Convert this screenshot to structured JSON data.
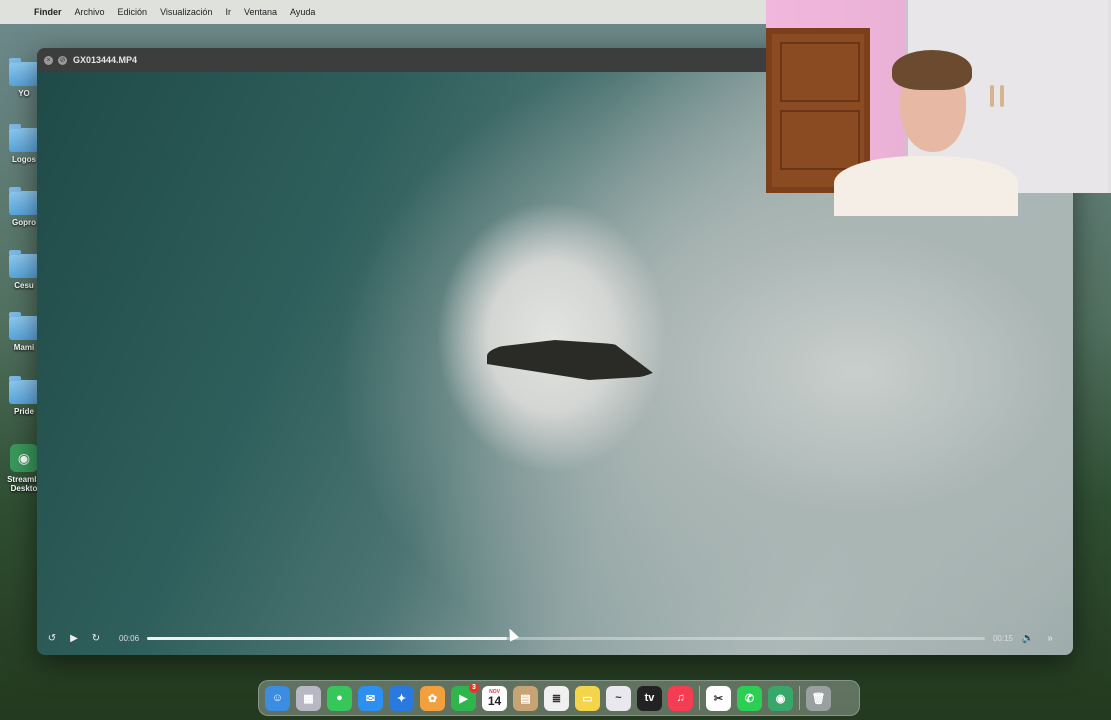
{
  "menubar": {
    "items": [
      "Finder",
      "Archivo",
      "Edición",
      "Visualización",
      "Ir",
      "Ventana",
      "Ayuda"
    ]
  },
  "desktop": {
    "icons": [
      {
        "label": "YO",
        "kind": "folder"
      },
      {
        "label": "Logos",
        "kind": "folder"
      },
      {
        "label": "Gopro",
        "kind": "folder"
      },
      {
        "label": "Cesu",
        "kind": "folder"
      },
      {
        "label": "Mami",
        "kind": "folder"
      },
      {
        "label": "Pride",
        "kind": "folder"
      },
      {
        "label": "Streamla Deskto",
        "kind": "app"
      }
    ]
  },
  "player": {
    "title": "GX013444.MP4",
    "time_current": "00:06",
    "time_total": "00:15",
    "progress": 0.43,
    "icons": [
      "back-10-icon",
      "play-icon",
      "forward-10-icon",
      "volume-icon",
      "fast-forward-icon"
    ]
  },
  "dock": {
    "apps": [
      {
        "name": "finder-app",
        "color": "#3a8de0",
        "glyph": "☺"
      },
      {
        "name": "launchpad-app",
        "color": "#b8b8c4",
        "glyph": "▦"
      },
      {
        "name": "messages-app",
        "color": "#35c759",
        "glyph": "●"
      },
      {
        "name": "mail-app",
        "color": "#2d8ff0",
        "glyph": "✉"
      },
      {
        "name": "safari-app",
        "color": "#2a79de",
        "glyph": "✦"
      },
      {
        "name": "photos-app",
        "color": "#f2a03d",
        "glyph": "✿"
      },
      {
        "name": "facetime-app",
        "color": "#2fb44e",
        "glyph": "▶",
        "badge": "3"
      },
      {
        "name": "calendar-app",
        "color": "#ffffff",
        "calendar_month": "NOV",
        "calendar_day": "14"
      },
      {
        "name": "notes-app",
        "color": "#c8a374",
        "glyph": "▤"
      },
      {
        "name": "reminders-app",
        "color": "#f0f0f0",
        "glyph": "≣"
      },
      {
        "name": "stickies-app",
        "color": "#f4d44a",
        "glyph": "▭"
      },
      {
        "name": "freeform-app",
        "color": "#e8e8ee",
        "glyph": "~"
      },
      {
        "name": "tv-app",
        "color": "#222222",
        "glyph": "tv"
      },
      {
        "name": "music-app",
        "color": "#f43c52",
        "glyph": "♫"
      },
      {
        "name": "capcut-app",
        "color": "#ffffff",
        "glyph": "✂"
      },
      {
        "name": "whatsapp-app",
        "color": "#2ccf54",
        "glyph": "✆"
      },
      {
        "name": "streamlabs-app",
        "color": "#37a86a",
        "glyph": "◉"
      }
    ],
    "trash": {
      "name": "trash-app",
      "color": "#9aa0a0",
      "glyph": "🗑"
    }
  }
}
